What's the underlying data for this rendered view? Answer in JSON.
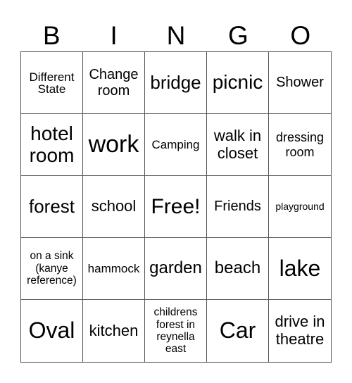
{
  "header": {
    "letters": [
      "B",
      "I",
      "N",
      "G",
      "O"
    ]
  },
  "cells": [
    "Different State",
    "Change room",
    "bridge",
    "picnic",
    "Shower",
    "hotel room",
    "work",
    "Camping",
    "walk in closet",
    "dressing room",
    "forest",
    "school",
    "Free!",
    "Friends",
    "playground",
    "on a sink (kanye reference)",
    "hammock",
    "garden",
    "beach",
    "lake",
    "Oval",
    "kitchen",
    "childrens forest in reynella east",
    "Car",
    "drive in theatre"
  ]
}
